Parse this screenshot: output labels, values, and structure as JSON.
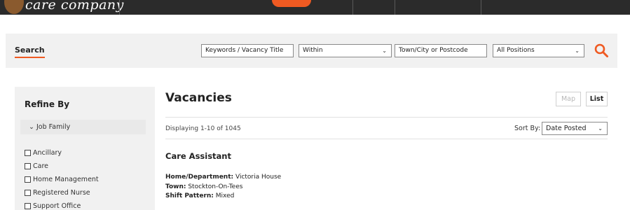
{
  "search": {
    "title": "Search",
    "keywords_placeholder": "Keywords / Vacancy Title",
    "within_value": "Within",
    "location_placeholder": "Town/City or Postcode",
    "positions_value": "All Positions"
  },
  "refine": {
    "title": "Refine By",
    "family_label": "Job Family",
    "items": [
      "Ancillary",
      "Care",
      "Home Management",
      "Registered Nurse",
      "Support Office"
    ]
  },
  "vacancies": {
    "title": "Vacancies",
    "map_label": "Map",
    "list_label": "List",
    "count_text": "Displaying 1-10 of 1045",
    "sort_label": "Sort By:",
    "sort_value": "Date Posted",
    "first": {
      "title": "Care Assistant",
      "home_label": "Home/Department:",
      "home_value": "Victoria House",
      "town_label": "Town:",
      "town_value": "Stockton-On-Tees",
      "shift_label": "Shift Pattern:",
      "shift_value": "Mixed"
    }
  },
  "colors": {
    "accent": "#ef5a22",
    "header_bg": "#2b2b2b",
    "panel_bg": "#f1f1f1"
  }
}
